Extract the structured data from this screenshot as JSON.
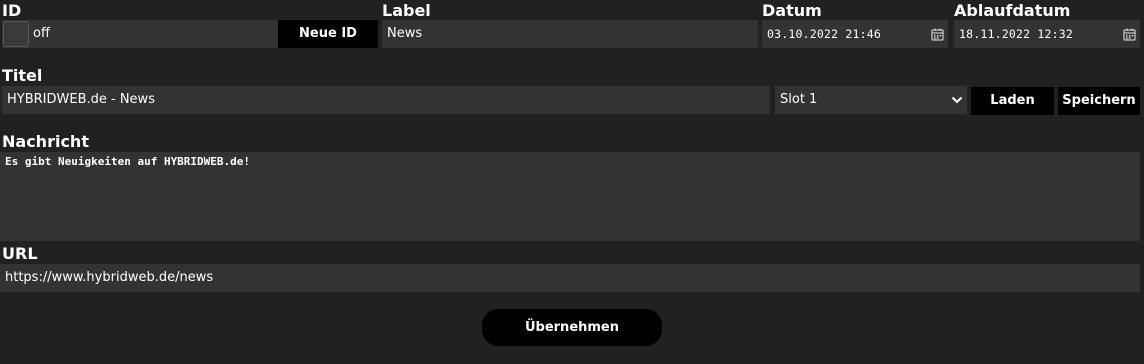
{
  "id_section": {
    "label": "ID",
    "checkbox_checked": false,
    "value": "off",
    "new_id_button": "Neue ID"
  },
  "label_section": {
    "label": "Label",
    "value": "News"
  },
  "datum_section": {
    "label": "Datum",
    "value": "03.10.2022 21:46",
    "icon": "calendar-icon"
  },
  "ablauf_section": {
    "label": "Ablaufdatum",
    "value": "18.11.2022 12:32",
    "icon": "calendar-icon"
  },
  "titel_section": {
    "label": "Titel",
    "value": "HYBRIDWEB.de - News",
    "slot_selected": "Slot 1",
    "load_button": "Laden",
    "save_button": "Speichern"
  },
  "nachricht_section": {
    "label": "Nachricht",
    "value": "Es gibt Neuigkeiten auf HYBRIDWEB.de!"
  },
  "url_section": {
    "label": "URL",
    "value": "https://www.hybridweb.de/news"
  },
  "submit_button": "Übernehmen",
  "colors": {
    "background": "#212121",
    "field": "#333333",
    "button": "#000000",
    "text": "#ffffff"
  }
}
